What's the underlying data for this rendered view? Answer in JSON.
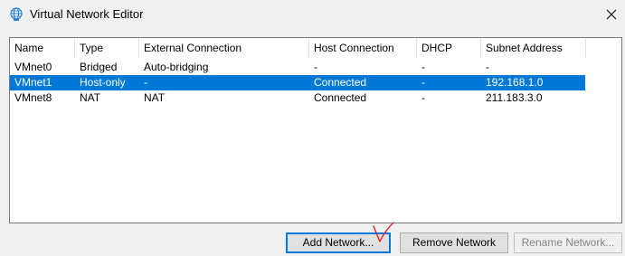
{
  "window": {
    "title": "Virtual Network Editor",
    "icon": "globe-network-icon",
    "close_icon": "close-icon"
  },
  "table": {
    "columns": [
      "Name",
      "Type",
      "External Connection",
      "Host Connection",
      "DHCP",
      "Subnet Address"
    ],
    "rows": [
      {
        "name": "VMnet0",
        "type": "Bridged",
        "external": "Auto-bridging",
        "host": "-",
        "dhcp": "-",
        "subnet": "-",
        "selected": false
      },
      {
        "name": "VMnet1",
        "type": "Host-only",
        "external": "-",
        "host": "Connected",
        "dhcp": "-",
        "subnet": "192.168.1.0",
        "selected": true
      },
      {
        "name": "VMnet8",
        "type": "NAT",
        "external": "NAT",
        "host": "Connected",
        "dhcp": "-",
        "subnet": "211.183.3.0",
        "selected": false
      }
    ]
  },
  "buttons": {
    "add_network": "Add Network...",
    "remove_network": "Remove Network",
    "rename_network": "Rename Network..."
  },
  "colors": {
    "selection": "#0078d7",
    "annotation": "#e0242a"
  }
}
